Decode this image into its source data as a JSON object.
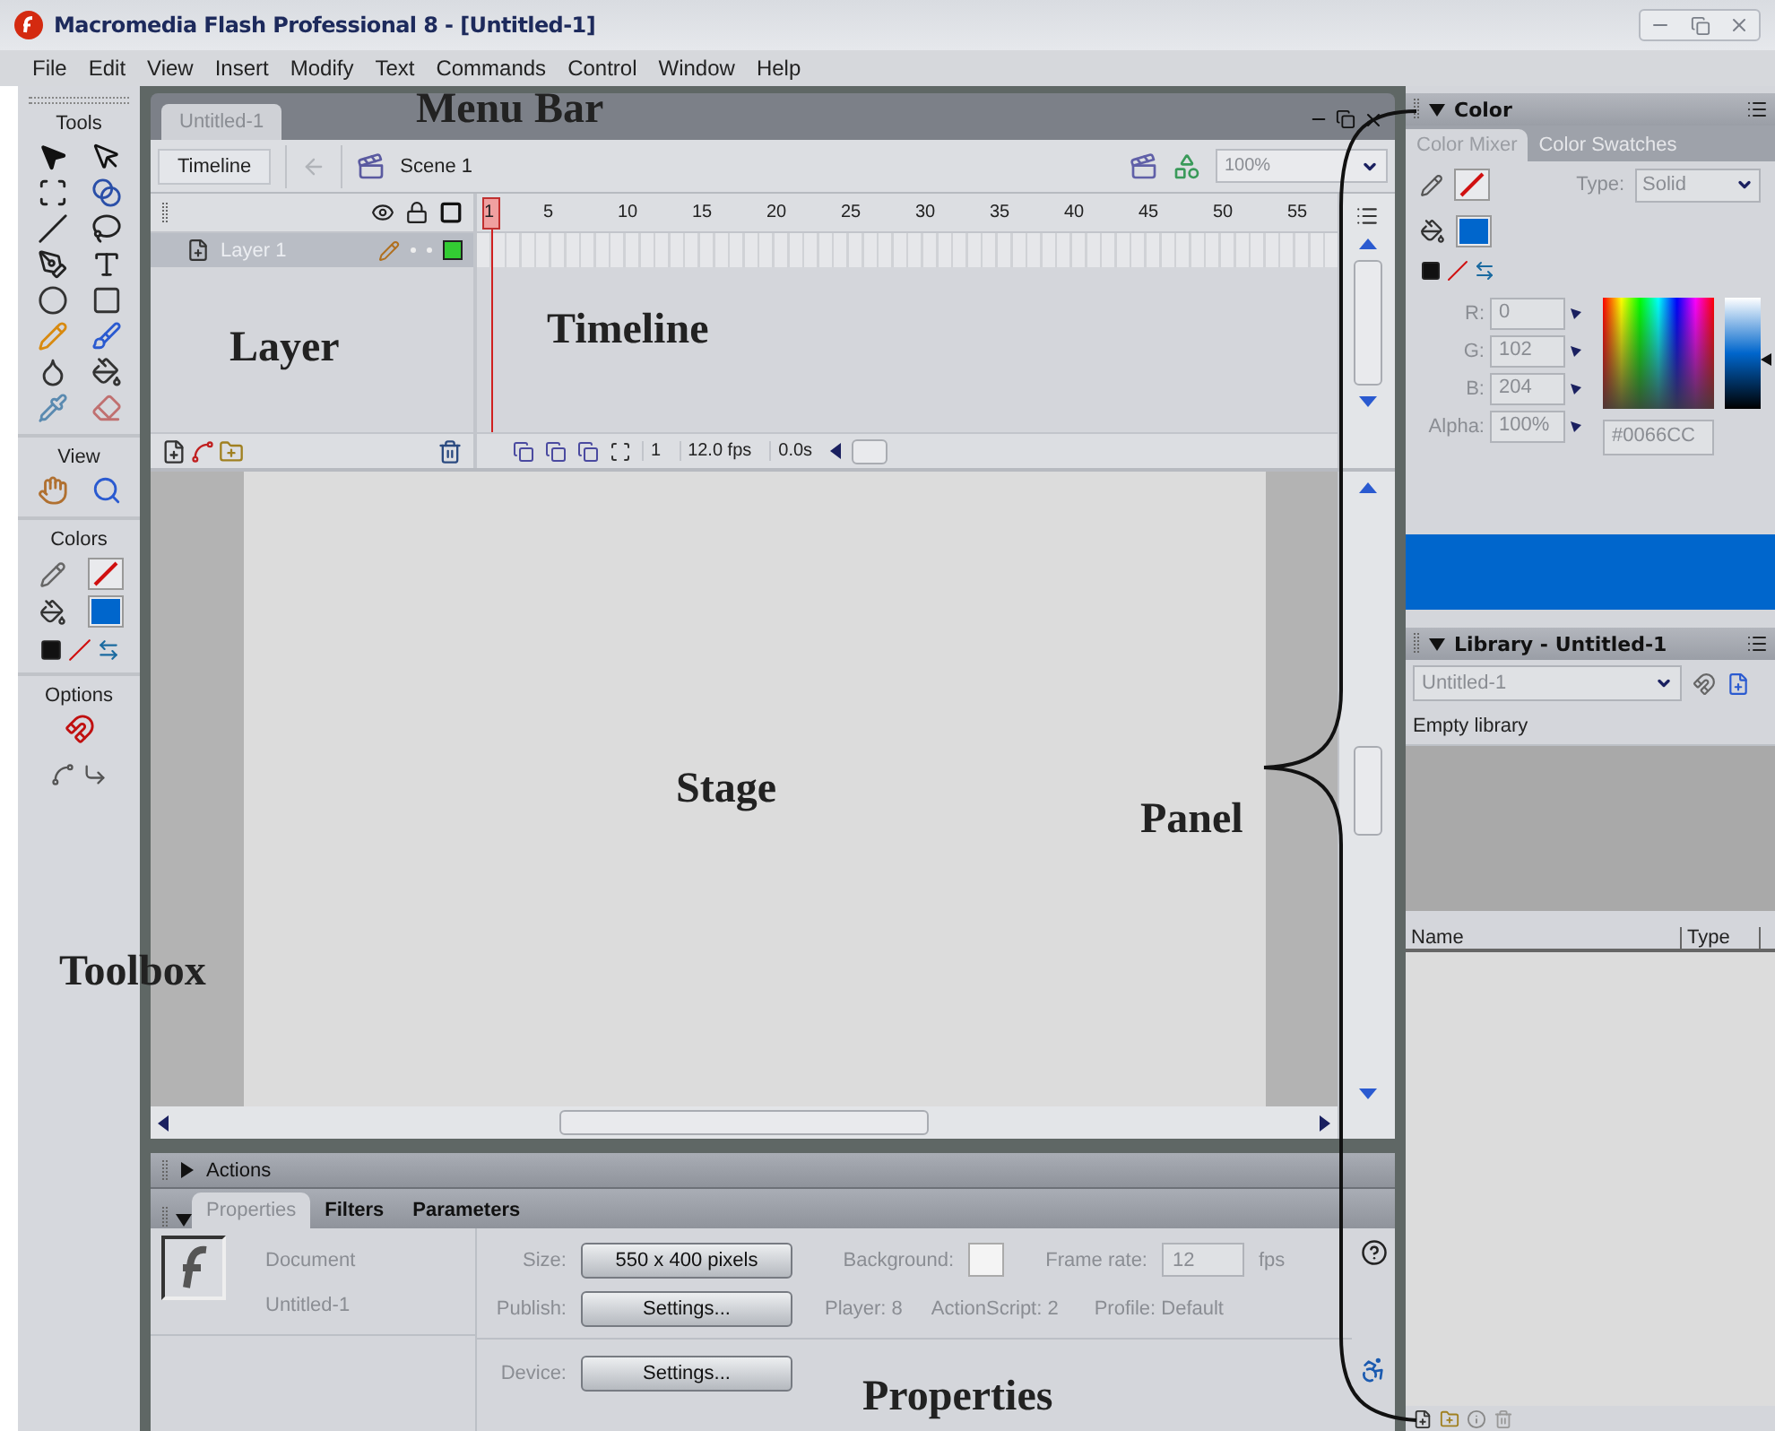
{
  "window": {
    "title": "Macromedia Flash Professional 8 - [Untitled-1]"
  },
  "menu_bar": [
    {
      "label": "File"
    },
    {
      "label": "Edit"
    },
    {
      "label": "View"
    },
    {
      "label": "Insert"
    },
    {
      "label": "Modify"
    },
    {
      "label": "Text"
    },
    {
      "label": "Commands"
    },
    {
      "label": "Control"
    },
    {
      "label": "Window"
    },
    {
      "label": "Help"
    }
  ],
  "toolbox": {
    "title": "Tools",
    "sections": [
      "View",
      "Colors",
      "Options"
    ]
  },
  "document": {
    "tab": "Untitled-1",
    "timeline_button": "Timeline",
    "scene": "Scene 1",
    "zoom": "100%",
    "timeline": {
      "frame_numbers": [
        "1",
        "5",
        "10",
        "15",
        "20",
        "25",
        "30",
        "35",
        "40",
        "45",
        "50",
        "55"
      ],
      "layers": [
        {
          "name": "Layer 1",
          "selected": true
        }
      ],
      "current_frame": "1",
      "frame_rate": "12.0 fps",
      "elapsed_time": "0.0s"
    }
  },
  "actions_panel": {
    "title": "Actions",
    "expanded": false
  },
  "properties_panel": {
    "expanded": true,
    "tabs": [
      {
        "label": "Properties",
        "selected": true
      },
      {
        "label": "Filters",
        "selected": false
      },
      {
        "label": "Parameters",
        "selected": false
      }
    ],
    "document_kind": "Document",
    "document_name": "Untitled-1",
    "size_label": "Size:",
    "size_value": "550 x 400 pixels",
    "publish_label": "Publish:",
    "publish_button": "Settings...",
    "background_label": "Background:",
    "frame_rate_label": "Frame rate:",
    "frame_rate": "12",
    "frame_rate_unit": "fps",
    "player": "Player: 8",
    "actionscript": "ActionScript: 2",
    "profile": "Profile: Default",
    "device_label": "Device:",
    "device_button": "Settings..."
  },
  "color_panel": {
    "title": "Color",
    "expanded": true,
    "tabs": [
      {
        "label": "Color Mixer",
        "selected": true
      },
      {
        "label": "Color Swatches",
        "selected": false
      }
    ],
    "type_label": "Type:",
    "type_value": "Solid",
    "channels": [
      {
        "label": "R:",
        "value": "0"
      },
      {
        "label": "G:",
        "value": "102"
      },
      {
        "label": "B:",
        "value": "204"
      },
      {
        "label": "Alpha:",
        "value": "100%"
      }
    ],
    "hex": "#0066CC"
  },
  "library_panel": {
    "title": "Library - Untitled-1",
    "expanded": true,
    "document": "Untitled-1",
    "status": "Empty library",
    "columns": [
      "Name",
      "Type"
    ]
  },
  "annotations": [
    "Menu Bar",
    "Layer",
    "Timeline",
    "Stage",
    "Panel",
    "Toolbox",
    "Properties"
  ]
}
